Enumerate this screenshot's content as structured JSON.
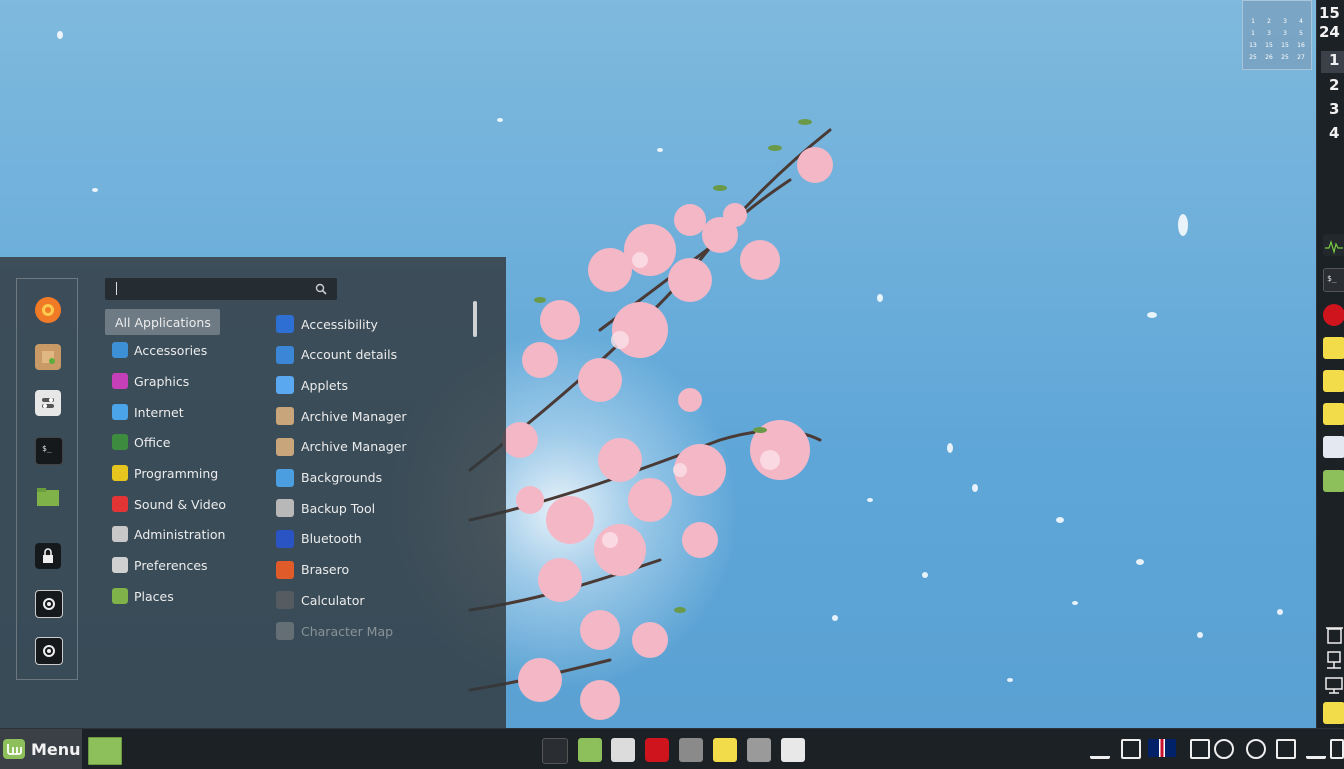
{
  "menu": {
    "button_label": "Menu",
    "search": {
      "placeholder": "",
      "value": ""
    },
    "favorites": [
      {
        "name": "firefox-icon"
      },
      {
        "name": "software-manager-icon"
      },
      {
        "name": "system-settings-icon"
      },
      {
        "name": "terminal-icon"
      },
      {
        "name": "files-icon"
      },
      {
        "name": "lock-screen-icon"
      },
      {
        "name": "logout-icon"
      },
      {
        "name": "shutdown-icon"
      }
    ],
    "categories": [
      {
        "label": "All Applications",
        "icon": "all-apps",
        "selected": true
      },
      {
        "label": "Accessories",
        "icon": "accessories-icon",
        "color": "#3d8fd6"
      },
      {
        "label": "Graphics",
        "icon": "graphics-icon",
        "color": "#c43fb8"
      },
      {
        "label": "Internet",
        "icon": "internet-icon",
        "color": "#4ba3e8"
      },
      {
        "label": "Office",
        "icon": "office-icon",
        "color": "#3d8b3f"
      },
      {
        "label": "Programming",
        "icon": "programming-icon",
        "color": "#e5c51e"
      },
      {
        "label": "Sound & Video",
        "icon": "sound-video-icon",
        "color": "#e33535"
      },
      {
        "label": "Administration",
        "icon": "administration-icon",
        "color": "#c8c8c8"
      },
      {
        "label": "Preferences",
        "icon": "preferences-icon",
        "color": "#d0d0d0"
      },
      {
        "label": "Places",
        "icon": "places-icon",
        "color": "#7fb34a"
      }
    ],
    "applications": [
      {
        "label": "Accessibility",
        "icon": "accessibility-icon",
        "color": "#2d6fd2"
      },
      {
        "label": "Account details",
        "icon": "account-details-icon",
        "color": "#3b86d6"
      },
      {
        "label": "Applets",
        "icon": "applets-icon",
        "color": "#5aa8ef"
      },
      {
        "label": "Archive Manager",
        "icon": "archive-manager-icon",
        "color": "#c9a57b"
      },
      {
        "label": "Archive Manager",
        "icon": "archive-manager-icon",
        "color": "#c9a57b"
      },
      {
        "label": "Backgrounds",
        "icon": "backgrounds-icon",
        "color": "#4b9ee0"
      },
      {
        "label": "Backup Tool",
        "icon": "backup-tool-icon",
        "color": "#b8b8b8"
      },
      {
        "label": "Bluetooth",
        "icon": "bluetooth-icon",
        "color": "#2a53c4"
      },
      {
        "label": "Brasero",
        "icon": "brasero-icon",
        "color": "#e05b2a"
      },
      {
        "label": "Calculator",
        "icon": "calculator-icon",
        "color": "#555b60"
      },
      {
        "label": "Character Map",
        "icon": "character-map-icon",
        "color": "#9a9a9a",
        "faded": true
      }
    ]
  },
  "taskbar": {
    "launchers": [
      {
        "name": "terminal-launcher",
        "color": "#2a2e32"
      },
      {
        "name": "files-launcher",
        "color": "#8dc05a"
      },
      {
        "name": "settings-launcher",
        "color": "#dcdcdc"
      },
      {
        "name": "opera-launcher",
        "color": "#d0141d"
      },
      {
        "name": "disk-launcher",
        "color": "#8a8a8a"
      },
      {
        "name": "sticky-notes-launcher",
        "color": "#f2dc4a"
      },
      {
        "name": "media-player-launcher",
        "color": "#9a9a9a"
      },
      {
        "name": "slack-launcher",
        "color": "#e8e8e8"
      }
    ],
    "tray": [
      {
        "name": "bluetooth-tray-icon"
      },
      {
        "name": "keyboard-tray-icon"
      },
      {
        "name": "uk-flag-tray-icon"
      },
      {
        "name": "screenshot-tray-icon"
      },
      {
        "name": "user-tray-icon"
      },
      {
        "name": "record-tray-icon"
      },
      {
        "name": "battery-tray-icon"
      },
      {
        "name": "wifi-tray-icon"
      },
      {
        "name": "display-tray-icon"
      }
    ]
  },
  "right_panel": {
    "clock_hour": "15",
    "clock_minute": "24",
    "workspaces": [
      "1",
      "2",
      "3",
      "4"
    ],
    "active_workspace": "1"
  },
  "calendar_desklet": {
    "rows": [
      [
        "",
        "",
        "",
        ""
      ],
      [
        "1",
        "2",
        "3",
        "4"
      ],
      [
        "1",
        "3",
        "3",
        "5"
      ],
      [
        "13",
        "15",
        "15",
        "16"
      ],
      [
        "25",
        "26",
        "25",
        "27"
      ]
    ]
  },
  "colors": {
    "panel_bg": "#1c2126",
    "menu_bg": "#32383c",
    "sky": "#6fb0db",
    "blossom": "#f3b7c6"
  }
}
